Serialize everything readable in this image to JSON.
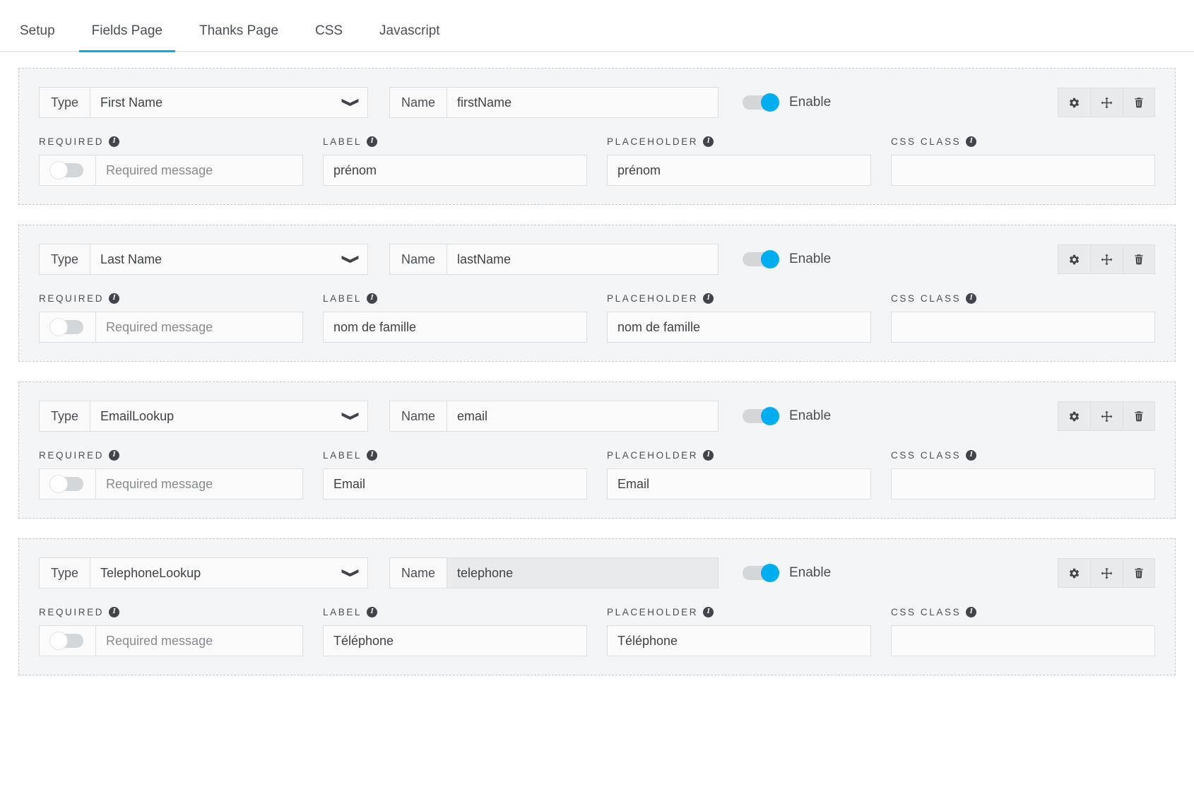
{
  "tabs": [
    {
      "label": "Setup",
      "active": false
    },
    {
      "label": "Fields Page",
      "active": true
    },
    {
      "label": "Thanks Page",
      "active": false
    },
    {
      "label": "CSS",
      "active": false
    },
    {
      "label": "Javascript",
      "active": false
    }
  ],
  "accent_color": "#00aeef",
  "column_headers": {
    "required": "REQUIRED",
    "label": "LABEL",
    "placeholder": "PLACEHOLDER",
    "css_class": "CSS CLASS"
  },
  "prefixes": {
    "type": "Type",
    "name": "Name"
  },
  "enable_label": "Enable",
  "required_message_placeholder": "Required message",
  "icons": {
    "chevron_down": "❯",
    "info": "i",
    "gear": "gear-icon",
    "move": "move-icon",
    "trash": "trash-icon"
  },
  "fields": [
    {
      "type": "First Name",
      "name": "firstName",
      "name_disabled": false,
      "enabled": true,
      "required": false,
      "required_message": "",
      "label": "prénom",
      "placeholder": "prénom",
      "css_class": ""
    },
    {
      "type": "Last Name",
      "name": "lastName",
      "name_disabled": false,
      "enabled": true,
      "required": false,
      "required_message": "",
      "label": "nom de famille",
      "placeholder": "nom de famille",
      "css_class": ""
    },
    {
      "type": "EmailLookup",
      "name": "email",
      "name_disabled": false,
      "enabled": true,
      "required": false,
      "required_message": "",
      "label": "Email",
      "placeholder": "Email",
      "css_class": ""
    },
    {
      "type": "TelephoneLookup",
      "name": "telephone",
      "name_disabled": true,
      "enabled": true,
      "required": false,
      "required_message": "",
      "label": "Téléphone",
      "placeholder": "Téléphone",
      "css_class": ""
    }
  ]
}
